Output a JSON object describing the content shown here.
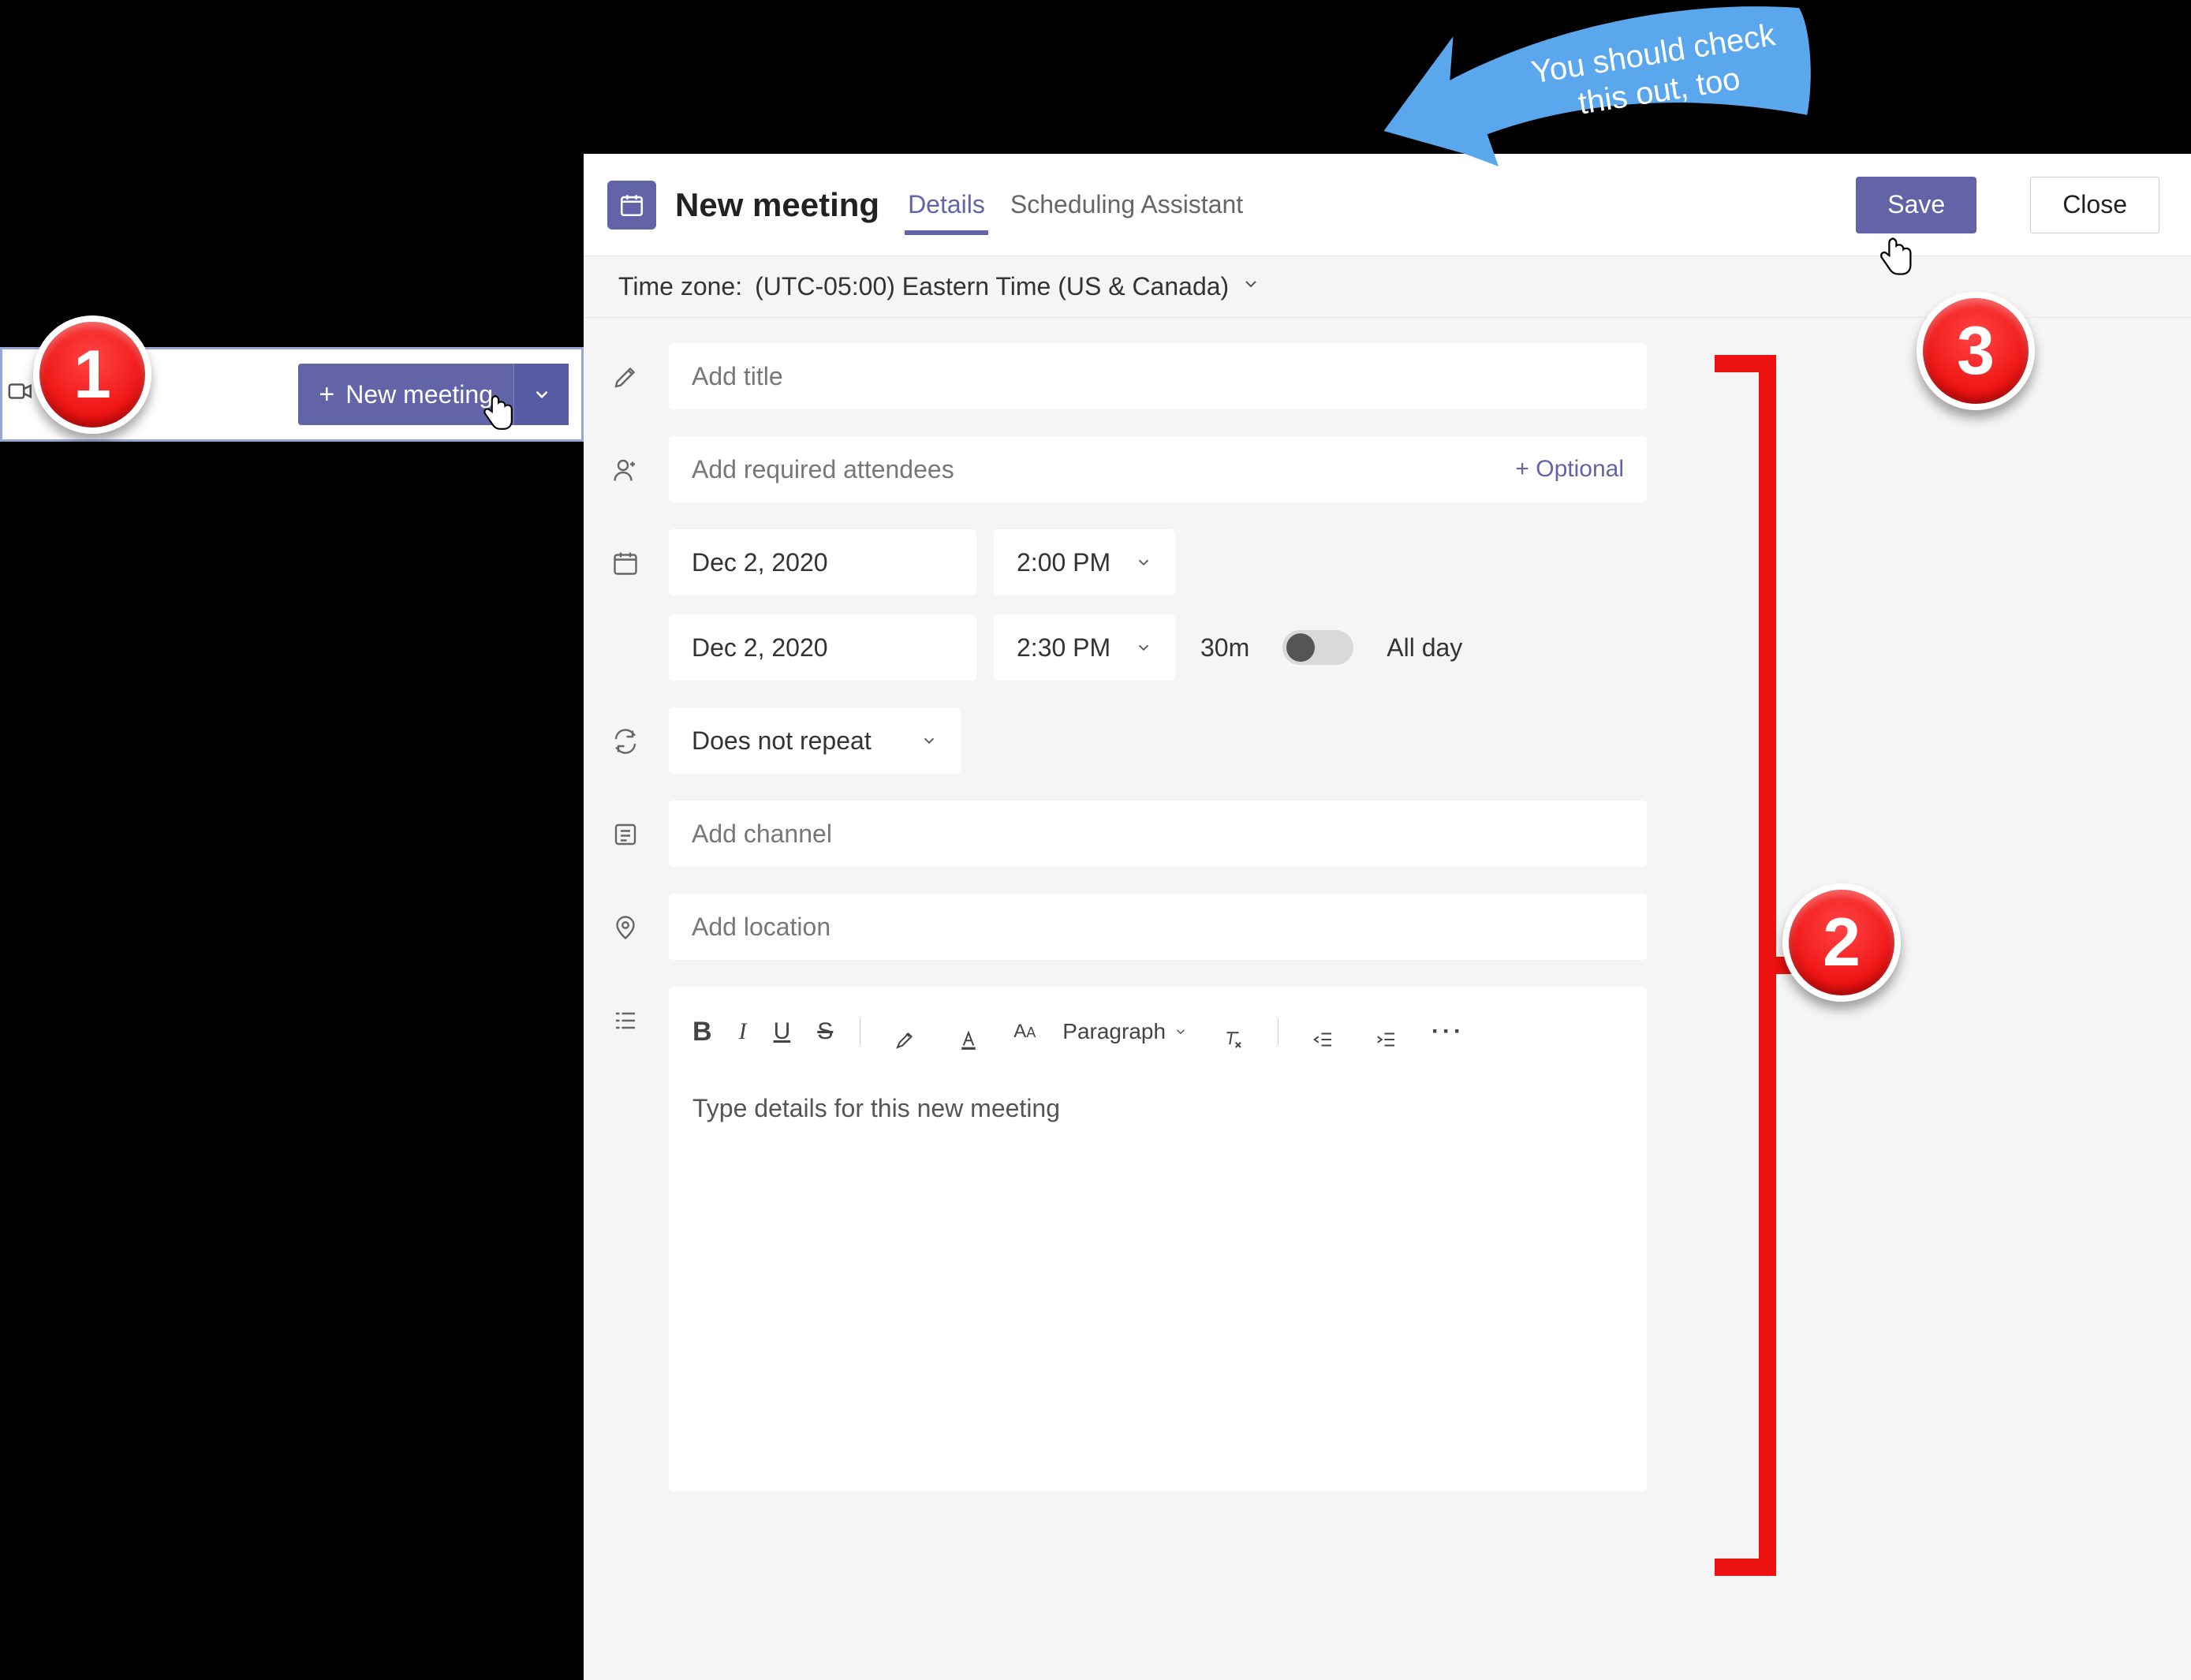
{
  "frag1": {
    "button_label": "New meeting"
  },
  "header": {
    "title": "New meeting",
    "tabs": [
      "Details",
      "Scheduling Assistant"
    ],
    "active_tab": 0,
    "save_label": "Save",
    "close_label": "Close"
  },
  "timezone": {
    "label": "Time zone:",
    "value": "(UTC-05:00) Eastern Time (US & Canada)"
  },
  "form": {
    "title_placeholder": "Add title",
    "attendees_placeholder": "Add required attendees",
    "optional_link": "+ Optional",
    "start_date": "Dec 2, 2020",
    "start_time": "2:00 PM",
    "end_date": "Dec 2, 2020",
    "end_time": "2:30 PM",
    "duration": "30m",
    "all_day_label": "All day",
    "recurrence": "Does not repeat",
    "channel_placeholder": "Add channel",
    "location_placeholder": "Add location",
    "editor": {
      "paragraph_label": "Paragraph",
      "placeholder": "Type details for this new meeting"
    }
  },
  "annotations": {
    "callout_text": "You should check this out, too",
    "step1": "1",
    "step2": "2",
    "step3": "3"
  }
}
